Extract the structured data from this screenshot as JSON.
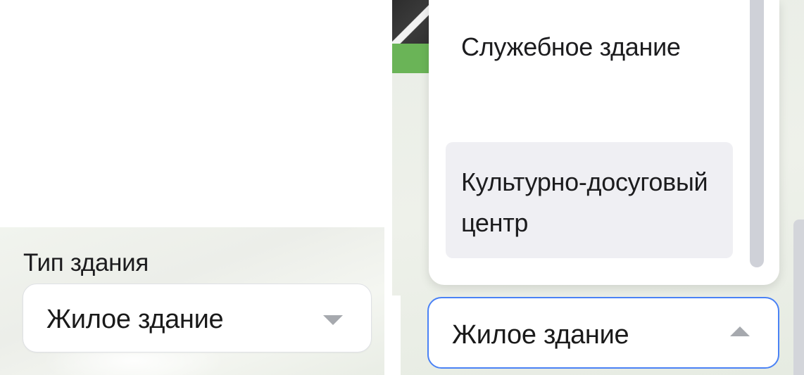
{
  "closed_select": {
    "label": "Тип здания",
    "value": "Жилое здание",
    "icon": "chevron-down-icon"
  },
  "open_select": {
    "value": "Жилое здание",
    "icon": "chevron-up-icon",
    "options": [
      {
        "label": "Служебное здание"
      },
      {
        "label": "Культурно-досуговый центр"
      }
    ],
    "hovered_option": 1
  },
  "colors": {
    "focus_border": "#4a82f5",
    "option_hover_bg": "#efeff3",
    "map_green": "#6ab457"
  }
}
